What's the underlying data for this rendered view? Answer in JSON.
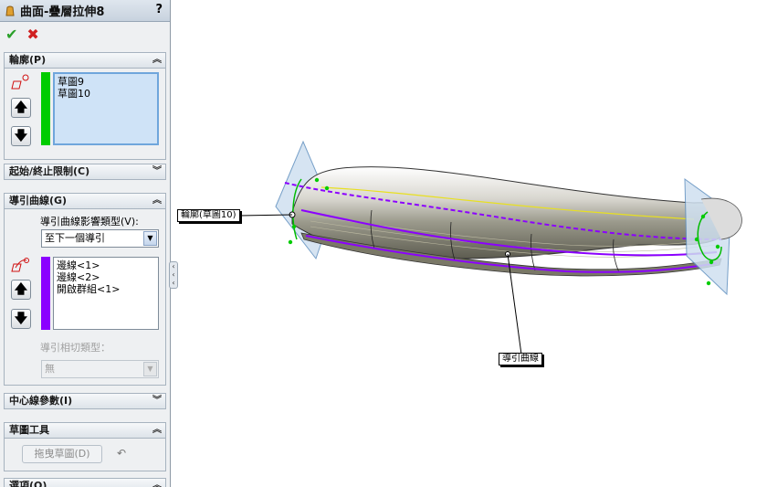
{
  "panel": {
    "title": "曲面-疊層拉伸8",
    "help": "?",
    "ok_icon": "checkmark-icon",
    "cancel_icon": "x-icon",
    "profiles": {
      "header": "輪廓(P)",
      "items": [
        "草圖9",
        "草圖10"
      ],
      "color": "#00cc00"
    },
    "constraints": {
      "header": "起始/終止限制(C)"
    },
    "guides": {
      "header": "導引曲線(G)",
      "influence_label": "導引曲線影響類型(V):",
      "influence_value": "至下一個導引",
      "items": [
        "邊線<1>",
        "邊線<2>",
        "開啟群組<1>"
      ],
      "color": "#8b00ff",
      "tangency_label": "導引相切類型：",
      "tangency_value": "無"
    },
    "centerline": {
      "header": "中心線參數(I)"
    },
    "sketch_tools": {
      "header": "草圖工具",
      "drag_button": "拖曳草圖(D)"
    },
    "options": {
      "header": "選項(O)"
    }
  },
  "viewport": {
    "callout_profile": "輪廓(草圖10)",
    "callout_guide": "導引曲線"
  }
}
